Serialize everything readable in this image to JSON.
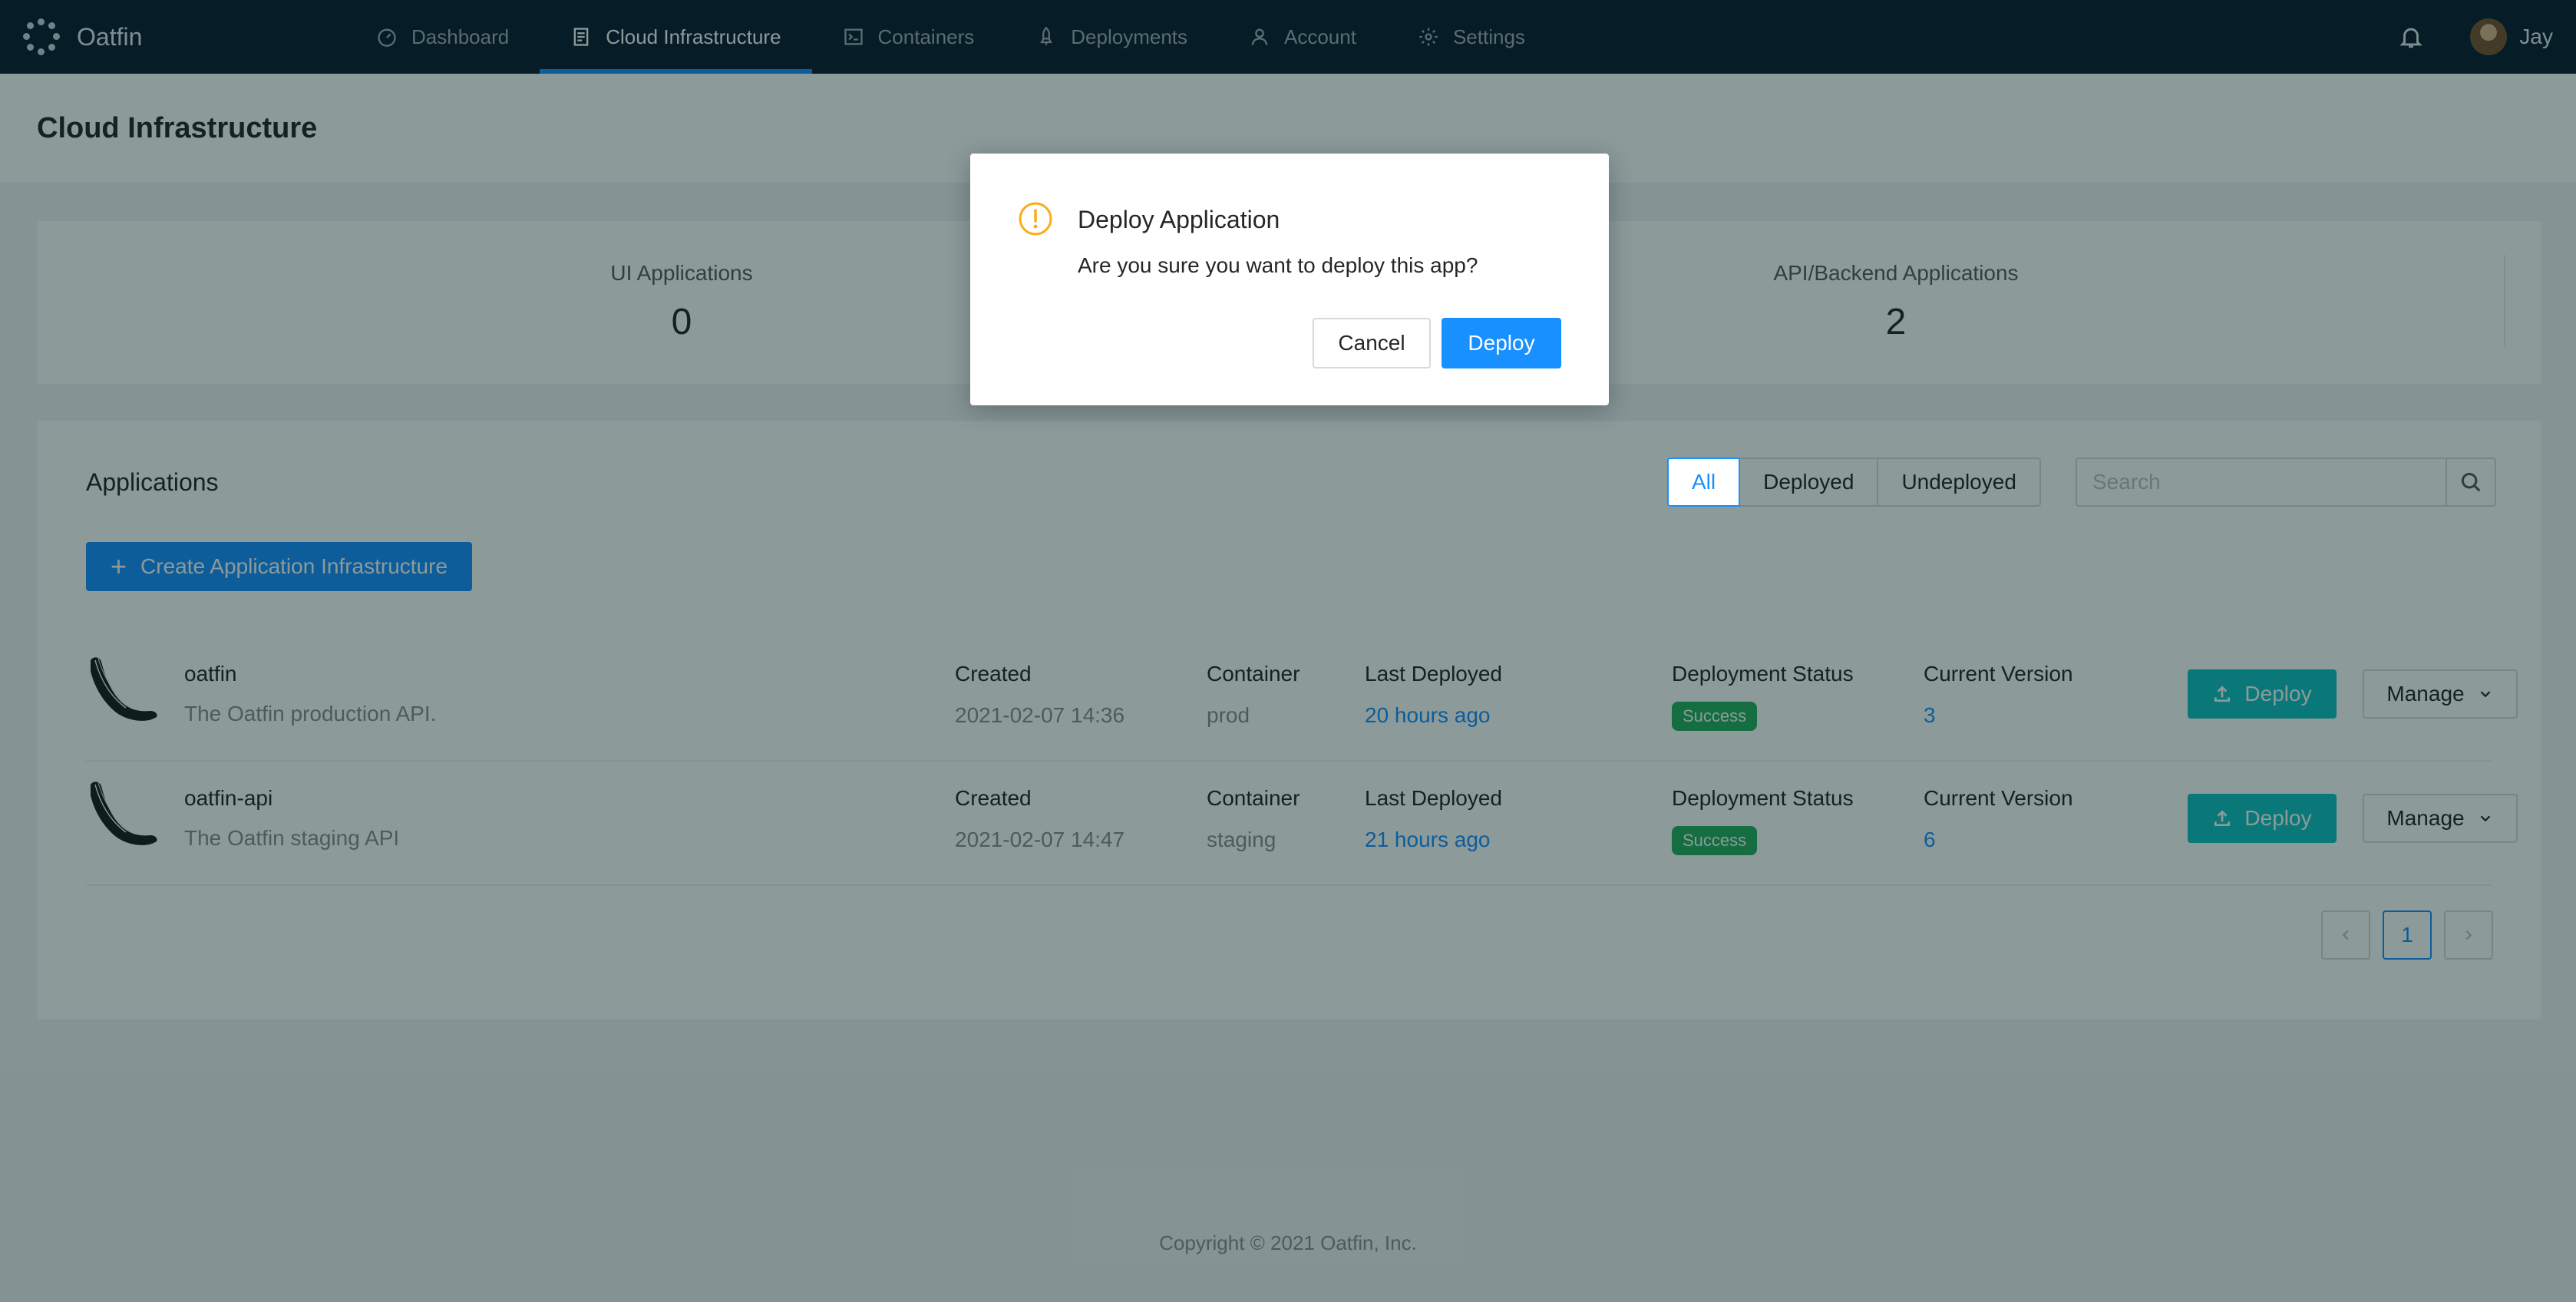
{
  "brand": {
    "name": "Oatfin"
  },
  "nav": {
    "items": [
      {
        "label": "Dashboard",
        "icon": "dashboard-icon"
      },
      {
        "label": "Cloud Infrastructure",
        "icon": "document-icon"
      },
      {
        "label": "Containers",
        "icon": "terminal-icon"
      },
      {
        "label": "Deployments",
        "icon": "rocket-icon"
      },
      {
        "label": "Account",
        "icon": "user-icon"
      },
      {
        "label": "Settings",
        "icon": "gear-icon"
      }
    ],
    "active": "Cloud Infrastructure",
    "user_name": "Jay"
  },
  "page": {
    "title": "Cloud Infrastructure"
  },
  "stats": [
    {
      "label": "UI Applications",
      "value": "0"
    },
    {
      "label": "API/Backend Applications",
      "value": "2"
    }
  ],
  "applications": {
    "title": "Applications",
    "filters": [
      "All",
      "Deployed",
      "Undeployed"
    ],
    "active_filter": "All",
    "search_placeholder": "Search",
    "create_label": "Create Application Infrastructure",
    "columns": {
      "created": "Created",
      "container": "Container",
      "last_deployed": "Last Deployed",
      "status": "Deployment Status",
      "version": "Current Version"
    },
    "deploy_label": "Deploy",
    "manage_label": "Manage",
    "rows": [
      {
        "name": "oatfin",
        "description": "The Oatfin production API.",
        "created": "2021-02-07 14:36",
        "container": "prod",
        "last_deployed": "20 hours ago",
        "status": "Success",
        "version": "3"
      },
      {
        "name": "oatfin-api",
        "description": "The Oatfin staging API",
        "created": "2021-02-07 14:47",
        "container": "staging",
        "last_deployed": "21 hours ago",
        "status": "Success",
        "version": "6"
      }
    ],
    "pagination": {
      "current": "1"
    }
  },
  "footer": {
    "text": "Copyright © 2021 Oatfin, Inc."
  },
  "modal": {
    "title": "Deploy Application",
    "message": "Are you sure you want to deploy this app?",
    "cancel_label": "Cancel",
    "ok_label": "Deploy",
    "icon": "warning-icon"
  },
  "colors": {
    "nav_bg": "#0b1a2c",
    "accent": "#1890ff",
    "deploy": "#13c2c2",
    "success": "#27ae60",
    "warning": "#faad14"
  }
}
